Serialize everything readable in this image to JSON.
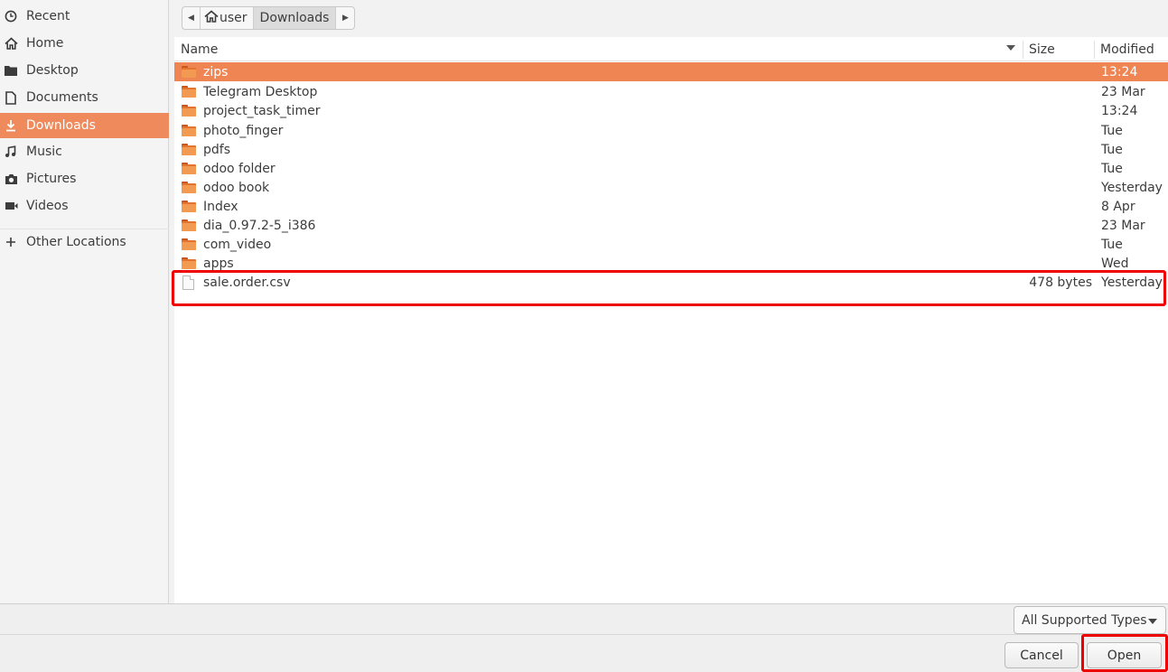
{
  "sidebar": {
    "items": [
      {
        "label": "Recent",
        "icon": "clock-icon",
        "active": false
      },
      {
        "label": "Home",
        "icon": "home-icon",
        "active": false
      },
      {
        "label": "Desktop",
        "icon": "desktop-folder-icon",
        "active": false
      },
      {
        "label": "Documents",
        "icon": "document-icon",
        "active": false
      },
      {
        "label": "Downloads",
        "icon": "download-icon",
        "active": true
      },
      {
        "label": "Music",
        "icon": "music-icon",
        "active": false
      },
      {
        "label": "Pictures",
        "icon": "camera-icon",
        "active": false
      },
      {
        "label": "Videos",
        "icon": "video-icon",
        "active": false
      }
    ],
    "other_locations": {
      "label": "Other Locations",
      "icon": "plus-icon"
    }
  },
  "pathbar": {
    "crumbs": [
      {
        "label": "user",
        "icon": "home-icon"
      },
      {
        "label": "Downloads",
        "current": true
      }
    ]
  },
  "file_list": {
    "columns": {
      "name": "Name",
      "size": "Size",
      "modified": "Modified"
    },
    "rows": [
      {
        "name": "zips",
        "type": "folder",
        "size": "",
        "modified": "13:24",
        "selected": true
      },
      {
        "name": "Telegram Desktop",
        "type": "folder",
        "size": "",
        "modified": "23 Mar"
      },
      {
        "name": "project_task_timer",
        "type": "folder",
        "size": "",
        "modified": "13:24"
      },
      {
        "name": "photo_finger",
        "type": "folder",
        "size": "",
        "modified": "Tue"
      },
      {
        "name": "pdfs",
        "type": "folder",
        "size": "",
        "modified": "Tue"
      },
      {
        "name": "odoo folder",
        "type": "folder",
        "size": "",
        "modified": "Tue"
      },
      {
        "name": "odoo book",
        "type": "folder",
        "size": "",
        "modified": "Yesterday"
      },
      {
        "name": "Index",
        "type": "folder",
        "size": "",
        "modified": "8 Apr"
      },
      {
        "name": "dia_0.97.2-5_i386",
        "type": "folder",
        "size": "",
        "modified": "23 Mar"
      },
      {
        "name": "com_video",
        "type": "folder",
        "size": "",
        "modified": "Tue"
      },
      {
        "name": "apps",
        "type": "folder",
        "size": "",
        "modified": "Wed"
      },
      {
        "name": "sale.order.csv",
        "type": "file",
        "size": "478 bytes",
        "modified": "Yesterday"
      }
    ]
  },
  "filter": {
    "selected": "All Supported Types"
  },
  "actions": {
    "cancel_label": "Cancel",
    "open_label": "Open"
  },
  "colors": {
    "accent": "#f08554",
    "highlight": "#ee0000"
  }
}
